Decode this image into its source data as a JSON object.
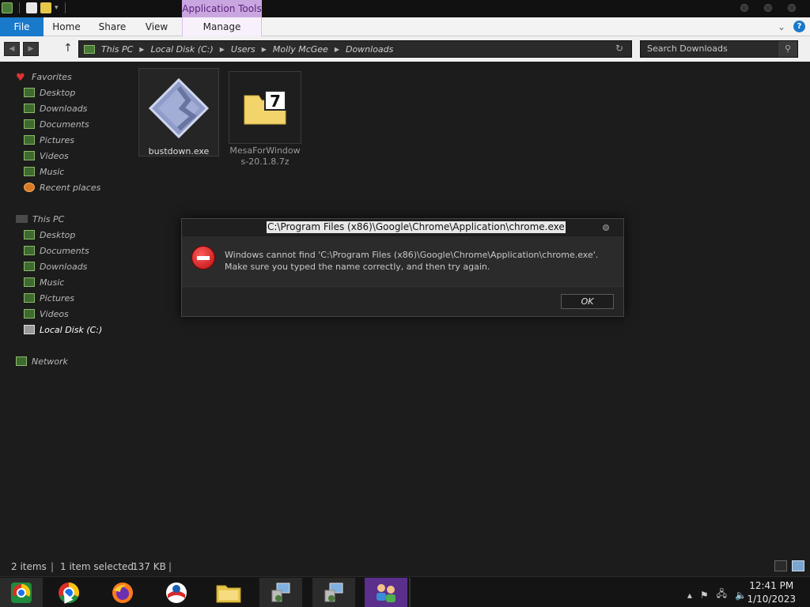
{
  "window": {
    "contextual_tab": "Application Tools"
  },
  "ribbon": {
    "tabs": [
      "File",
      "Home",
      "Share",
      "View",
      "Manage"
    ],
    "help_label": "?"
  },
  "address": {
    "crumbs": [
      "This PC",
      "Local Disk (C:)",
      "Users",
      "Molly McGee",
      "Downloads"
    ],
    "search_placeholder": "Search Downloads"
  },
  "sidebar": {
    "favorites_label": "Favorites",
    "favorites": [
      "Desktop",
      "Downloads",
      "Documents",
      "Pictures",
      "Videos",
      "Music",
      "Recent places"
    ],
    "this_pc_label": "This PC",
    "this_pc": [
      "Desktop",
      "Documents",
      "Downloads",
      "Music",
      "Pictures",
      "Videos",
      "Local Disk (C:)"
    ],
    "network_label": "Network"
  },
  "files": [
    {
      "name": "bustdown.exe",
      "icon": "executable-icon",
      "selected": true
    },
    {
      "name_line1": "MesaForWindow",
      "name_line2": "s-20.1.8.7z",
      "icon": "7zip-archive-icon",
      "selected": false
    }
  ],
  "dialog": {
    "title": "C:\\Program Files (x86)\\Google\\Chrome\\Application\\chrome.exe",
    "message": "Windows cannot find 'C:\\Program Files (x86)\\Google\\Chrome\\Application\\chrome.exe'. Make sure you typed the name correctly, and then try again.",
    "ok_label": "OK",
    "icon": "error-icon"
  },
  "status": {
    "item_count": "2 items",
    "selection": "1 item selected",
    "size": "137 KB"
  },
  "taskbar": {
    "apps": [
      "chromium-icon",
      "chrome-icon",
      "firefox-icon",
      "opera-icon",
      "file-explorer-icon",
      "network-setup-icon",
      "network-setup-icon",
      "users-icon"
    ],
    "time": "12:41 PM",
    "date": "1/10/2023"
  },
  "colors": {
    "file_tab": "#1979ca",
    "app_tools": "#c9a6e0",
    "error_red": "#d01818"
  }
}
